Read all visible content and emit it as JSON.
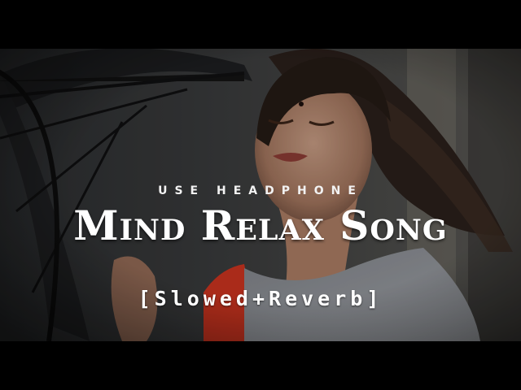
{
  "overlay": {
    "tagline": "USE HEADPHONE",
    "title": "Mind Relax Song",
    "subtitle": "[Slowed+Reverb]"
  },
  "colors": {
    "text": "#ffffff",
    "letterbox": "#000000",
    "dress": "#c8331f",
    "scarf": "#8d9096"
  }
}
